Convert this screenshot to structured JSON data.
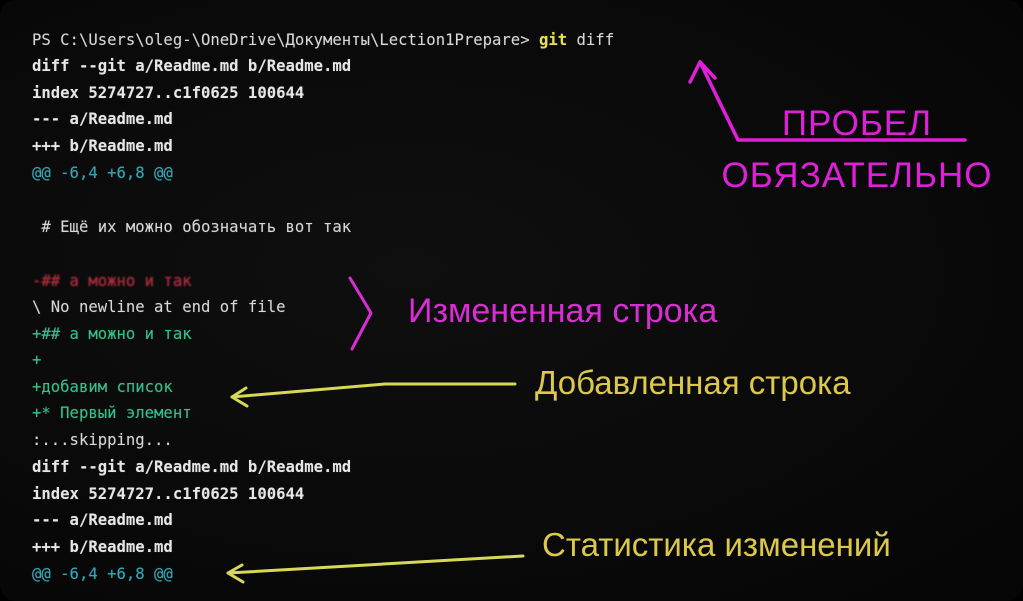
{
  "terminal": {
    "prompt_path": "PS C:\\Users\\oleg-\\OneDrive\\Документы\\Lection1Prepare> ",
    "command_git": "git",
    "command_rest": " diff",
    "block1": {
      "diff_header": "diff --git a/Readme.md b/Readme.md",
      "index_line": "index 5274727..c1f0625 100644",
      "old_file": "--- a/Readme.md",
      "new_file": "+++ b/Readme.md",
      "hunk_header": "@@ -6,4 +6,8 @@"
    },
    "context_line": " # Ещё их можно обозначать вот так",
    "removed_line": "-## а можно и так",
    "no_newline": "\\ No newline at end of file",
    "added_lines": [
      "+## а можно и так",
      "+",
      "+добавим список",
      "+* Первый элемент"
    ],
    "skipping": ":...skipping...",
    "block2": {
      "diff_header": "diff --git a/Readme.md b/Readme.md",
      "index_line": "index 5274727..c1f0625 100644",
      "old_file": "--- a/Readme.md",
      "new_file": "+++ b/Readme.md",
      "hunk_header": "@@ -6,4 +6,8 @@"
    }
  },
  "annotations": {
    "space_required_line1": "ПРОБЕЛ",
    "space_required_line2": "ОБЯЗАТЕЛЬНО",
    "changed_line": "Измененная строка",
    "added_line": "Добавленная строка",
    "change_stats": "Статистика изменений"
  },
  "colors": {
    "background": "#0a0a0a",
    "terminal_text": "#d8d8d8",
    "git_command": "#e8e050",
    "hunk_header": "#2fa9b8",
    "added": "#2bc48a",
    "removed": "#c2263a",
    "magenta_annotation": "#e020d8",
    "yellow_annotation": "#dcc84a"
  }
}
